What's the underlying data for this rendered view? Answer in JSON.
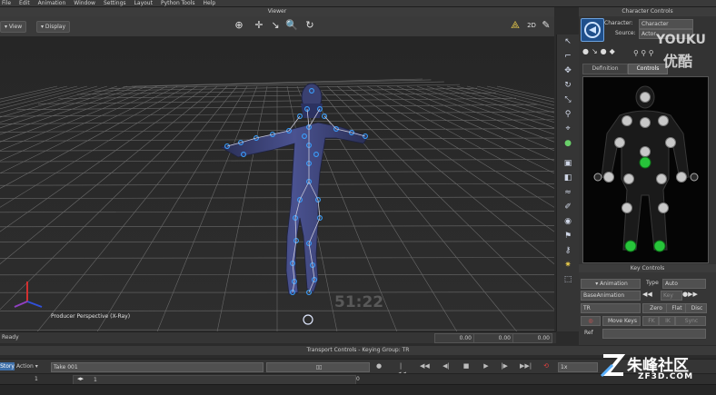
{
  "menu": [
    "File",
    "Edit",
    "Animation",
    "Window",
    "Settings",
    "Layout",
    "Python Tools",
    "Help"
  ],
  "viewer": {
    "title": "Viewer",
    "view_label": "View",
    "display_label": "Display",
    "camera_label": "Producer Perspective (X-Ray)",
    "timecode": "51:22",
    "readout": [
      "0.00",
      "0.00",
      "0.00"
    ]
  },
  "status": "Ready",
  "character_controls": {
    "title": "Character Controls",
    "character_label": "Character:",
    "character_value": "Character",
    "source_label": "Source:",
    "source_value": "Actor",
    "tabs": [
      "Definition",
      "Controls"
    ]
  },
  "key_controls": {
    "title": "Key Controls",
    "animation_label": "Animation",
    "type_label": "Type",
    "type_value": "Auto",
    "layer_value": "BaseAnimation",
    "key_label": "Key",
    "tr_value": "TR",
    "zero_label": "Zero",
    "flat_label": "Flat",
    "disc_label": "Disc",
    "move_keys_label": "Move Keys",
    "fk_label": "FK",
    "ik_label": "IK",
    "sync_label": "Sync",
    "ref_label": "Ref"
  },
  "transport": {
    "title": "Transport Controls  -  Keying Group: TR",
    "story_label": "Story",
    "action_label": "Action",
    "take_value": "Take 001",
    "speed_value": "1x",
    "frame_start": "1",
    "frame_current": "1",
    "frame_marker": "0"
  },
  "watermarks": {
    "youku_top": "YOUKU",
    "youku_bottom": "优酷",
    "zf3d_top": "朱峰社区",
    "zf3d_bottom": "ZF3D.COM"
  },
  "colors": {
    "accent_green": "#27c43a",
    "joint_blue": "#3aa0ff",
    "grid": "#6a6a6a"
  }
}
